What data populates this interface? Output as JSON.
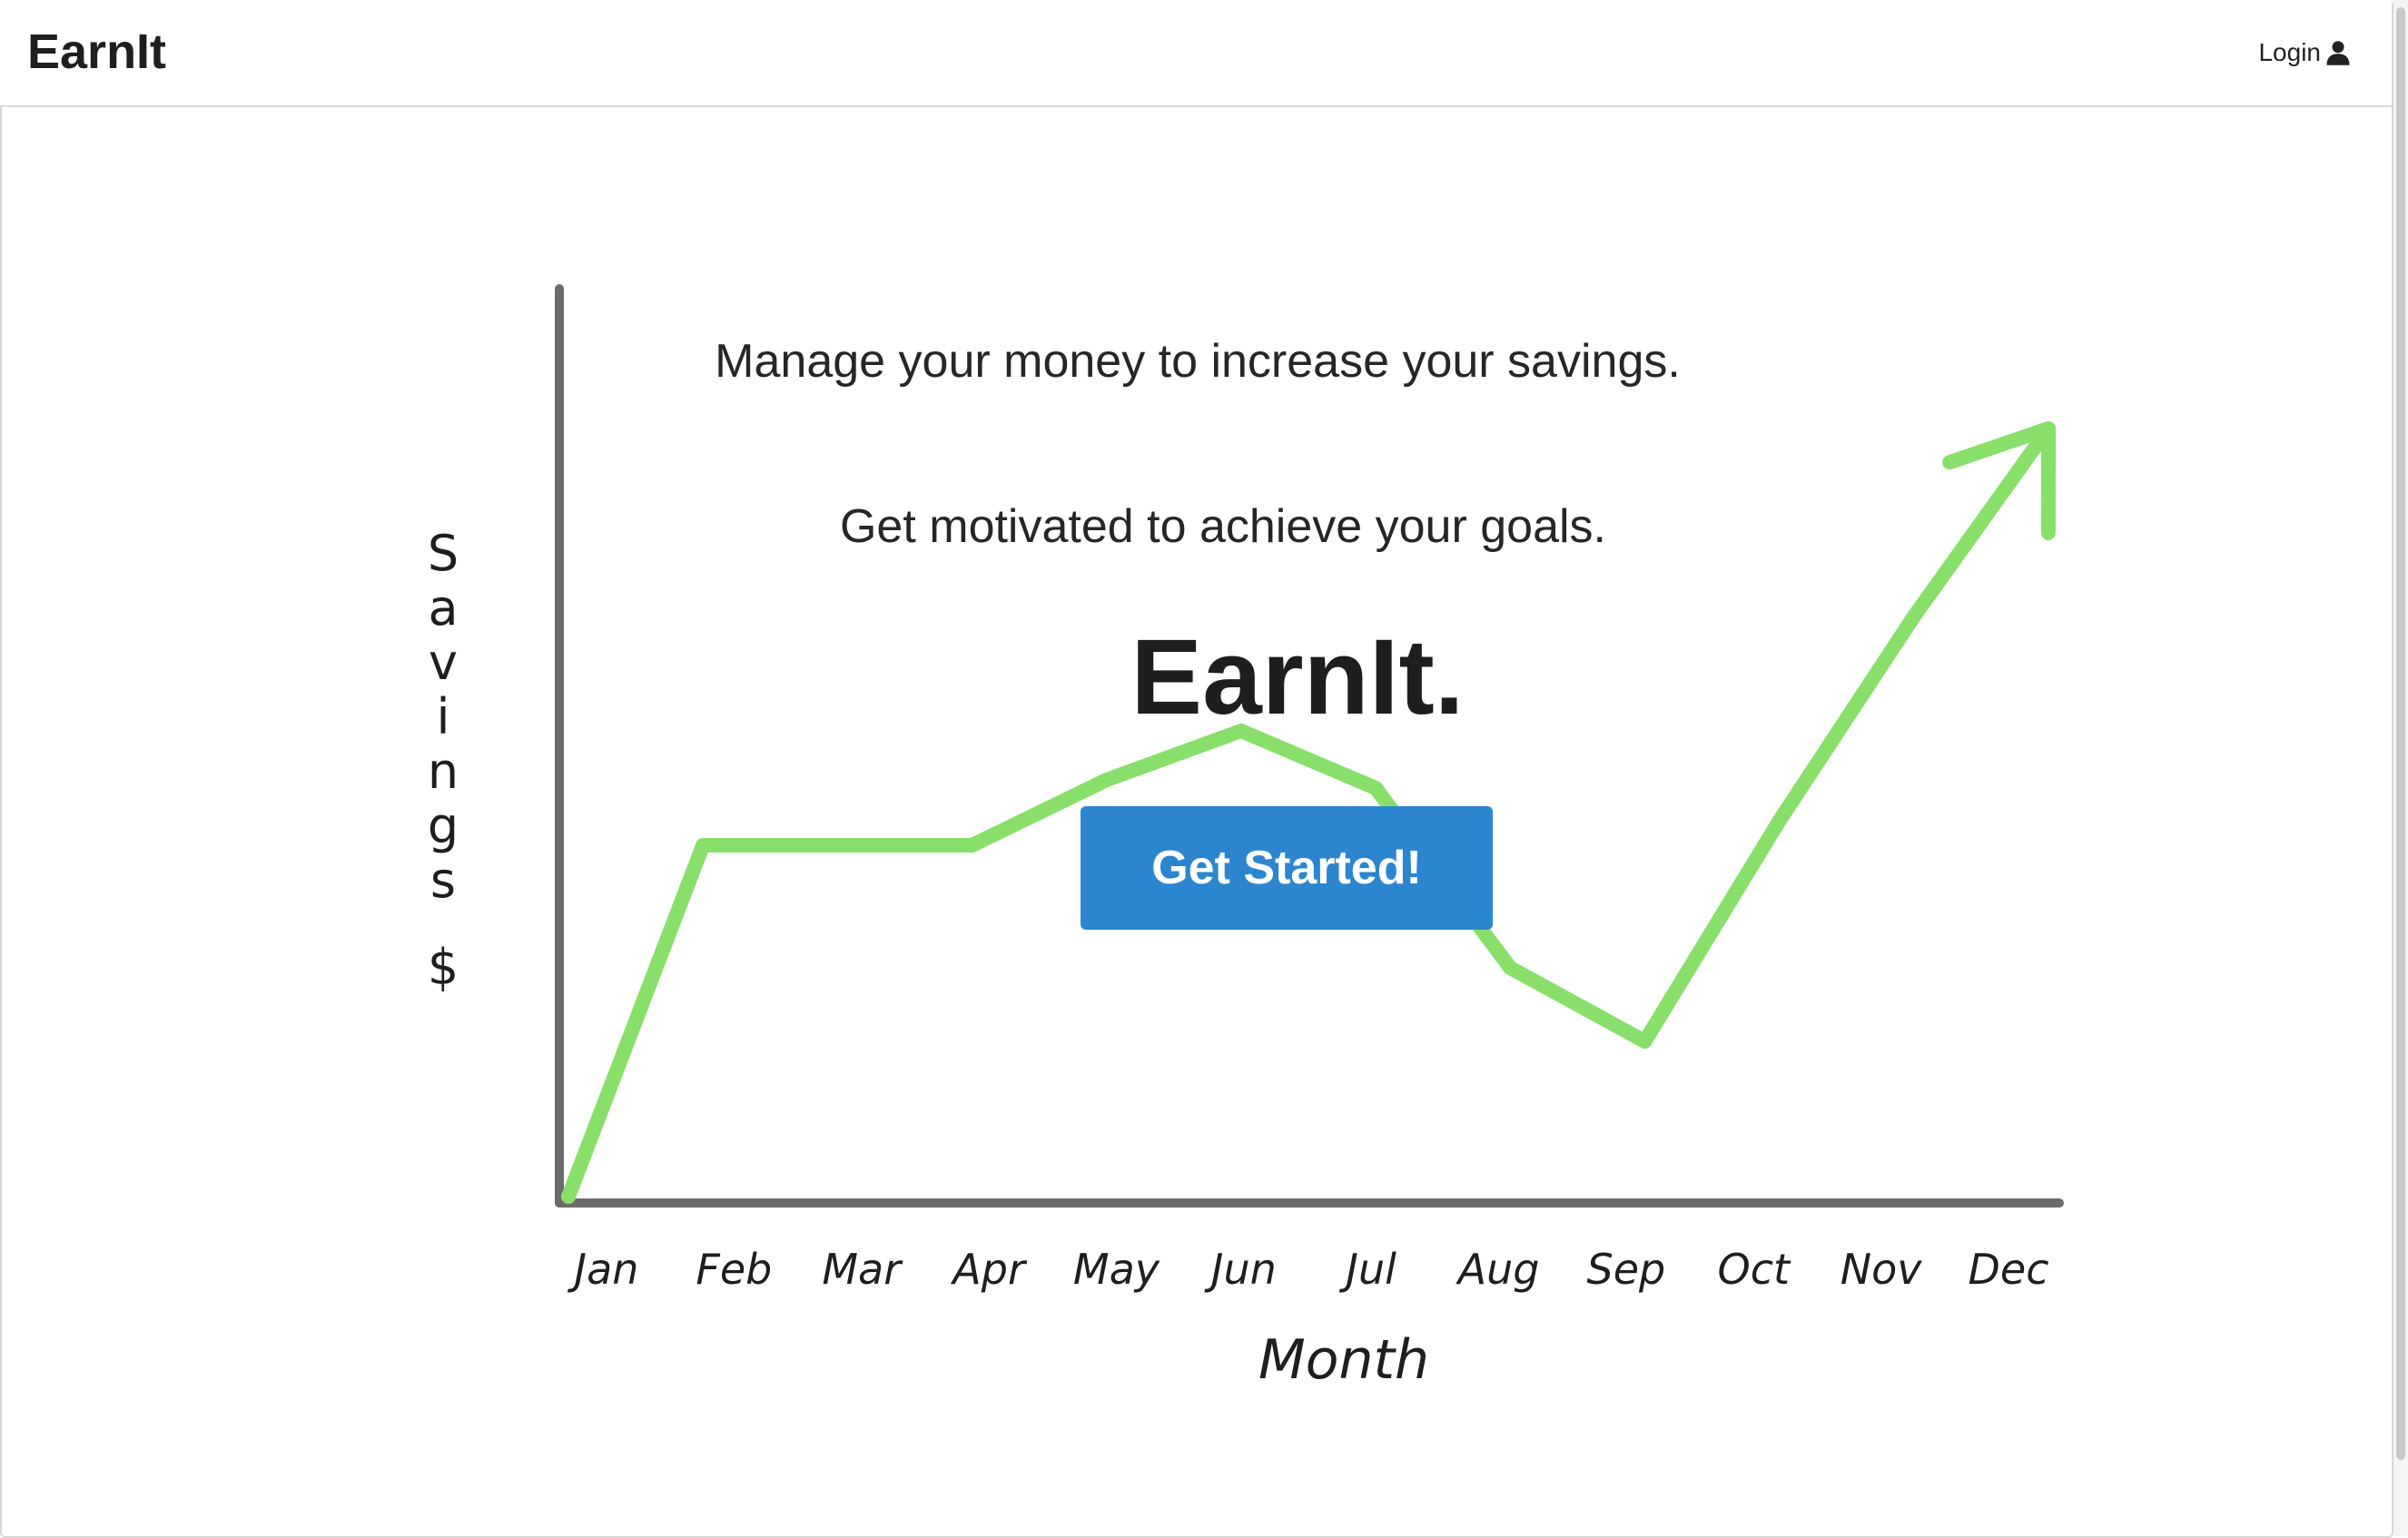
{
  "navbar": {
    "brand": "EarnIt",
    "login_label": "Login",
    "login_icon": "user-icon"
  },
  "hero": {
    "tagline_1": "Manage your money to increase your savings.",
    "tagline_2": "Get motivated to achieve your goals.",
    "headline": "EarnIt.",
    "cta_label": "Get Started!"
  },
  "chart_data": {
    "type": "line",
    "categories": [
      "Jan",
      "Feb",
      "Mar",
      "Apr",
      "May",
      "Jun",
      "Jul",
      "Aug",
      "Sep",
      "Oct",
      "Nov",
      "Dec"
    ],
    "series": [
      {
        "values": [
          0,
          4.3,
          4.3,
          4.3,
          5.1,
          5.7,
          5.0,
          2.8,
          1.9,
          4.6,
          7.1,
          9.4
        ]
      }
    ],
    "xlabel": "Month",
    "ylabel": "Savings $",
    "ylim": [
      0,
      10
    ],
    "grid": false,
    "end_arrow": true,
    "colors": {
      "line": "#88df6a",
      "axes": "#6b6b6b"
    }
  },
  "colors": {
    "accent": "#2b86cf",
    "border": "#d8d8d8"
  }
}
